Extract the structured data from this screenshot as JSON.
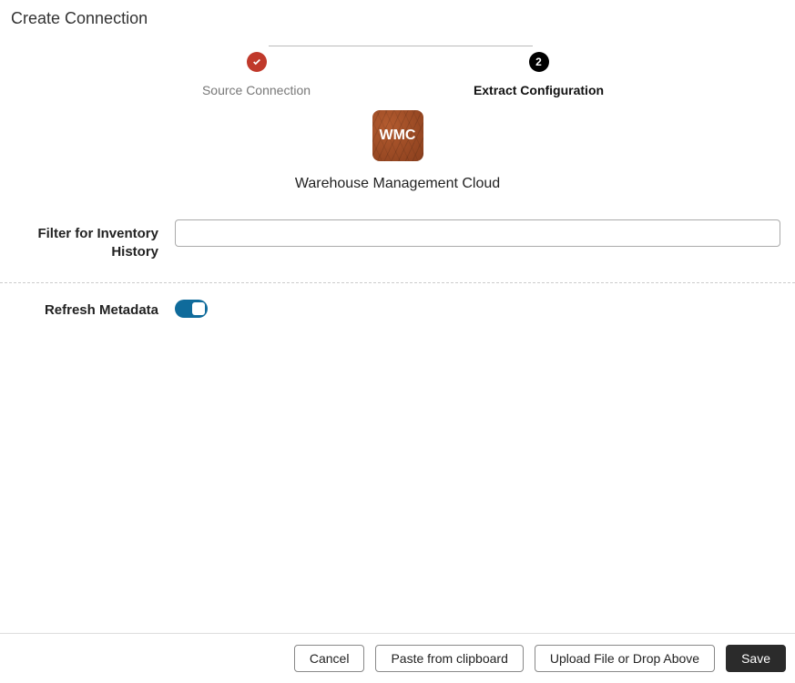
{
  "pageTitle": "Create Connection",
  "stepper": {
    "steps": [
      {
        "label": "Source Connection",
        "state": "done"
      },
      {
        "label": "Extract Configuration",
        "state": "current",
        "number": "2"
      }
    ]
  },
  "connection": {
    "tileText": "WMC",
    "name": "Warehouse Management Cloud"
  },
  "form": {
    "filterLabel": "Filter for Inventory History",
    "filterValue": "",
    "refreshLabel": "Refresh Metadata",
    "refreshOn": true
  },
  "footer": {
    "cancel": "Cancel",
    "paste": "Paste from clipboard",
    "upload": "Upload File or Drop Above",
    "save": "Save"
  }
}
